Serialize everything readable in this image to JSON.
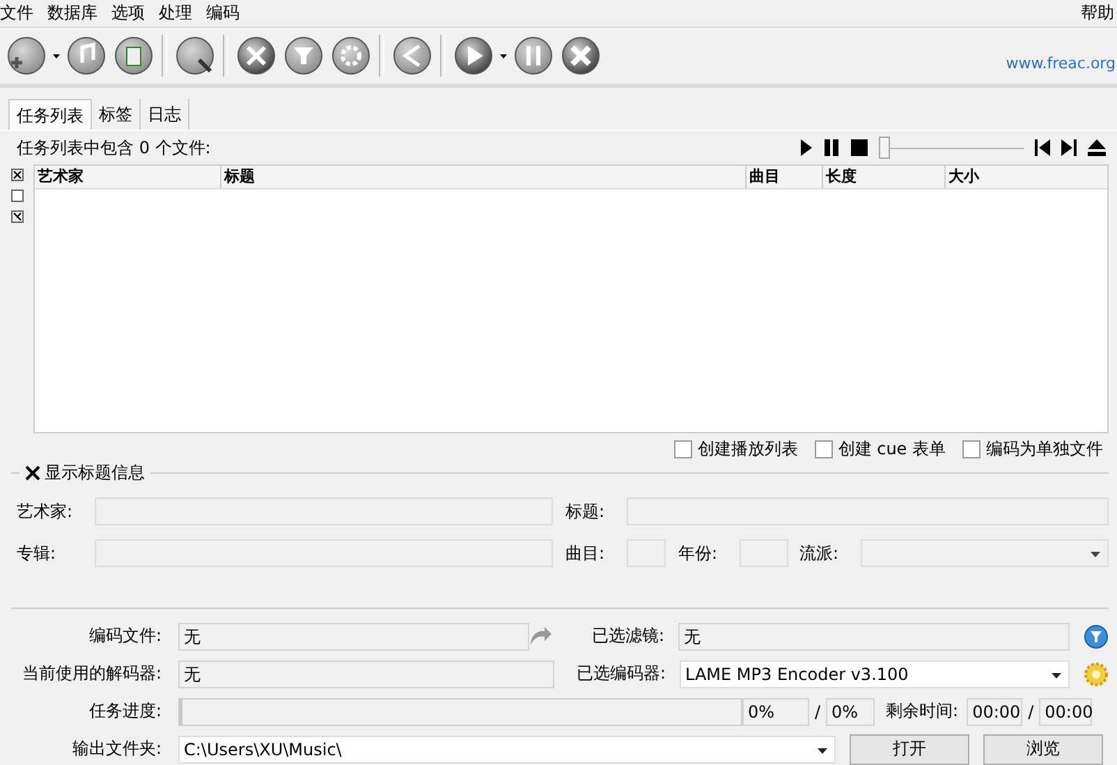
{
  "menu": {
    "items": [
      "文件",
      "数据库",
      "选项",
      "处理",
      "编码"
    ],
    "help": "帮助"
  },
  "toolbar": {
    "link": "www.freac.org"
  },
  "tabs": [
    {
      "label": "任务列表",
      "selected": true
    },
    {
      "label": "标签",
      "selected": false
    },
    {
      "label": "日志",
      "selected": false
    }
  ],
  "joblist": {
    "summary": "任务列表中包含 0 个文件:",
    "player_position": {
      "level": 0
    },
    "columns": [
      "艺术家",
      "标题",
      "曲目",
      "长度",
      "大小"
    ]
  },
  "options": [
    {
      "label": "创建播放列表",
      "checked": false
    },
    {
      "label": "创建 cue 表单",
      "checked": false
    },
    {
      "label": "编码为单独文件",
      "checked": false
    }
  ],
  "title_info": {
    "label": "显示标题信息",
    "checked": true,
    "artist_label": "艺术家:",
    "title_label": "标题:",
    "album_label": "专辑:",
    "track_label": "曲目:",
    "year_label": "年份:",
    "genre_label": "流派:"
  },
  "status": {
    "encoding_label": "编码文件:",
    "encoding_value": "无",
    "filter_label": "已选滤镜:",
    "filter_value": "无",
    "decoder_label": "当前使用的解码器:",
    "decoder_value": "无",
    "encoder_label": "已选编码器:",
    "encoder_value": "LAME MP3 Encoder v3.100",
    "progress_label": "任务进度:",
    "progress": {
      "level": 0
    },
    "percent_file": "0%",
    "slash_1": "/",
    "percent_total": "0%",
    "remaining_label": "剩余时间:",
    "time_file": "00:00",
    "slash_2": "/",
    "time_total": "00:00",
    "output_label": "输出文件夹:",
    "output_value": "C:\\Users\\XU\\Music\\",
    "open_button": "打开",
    "browse_button": "浏览"
  }
}
